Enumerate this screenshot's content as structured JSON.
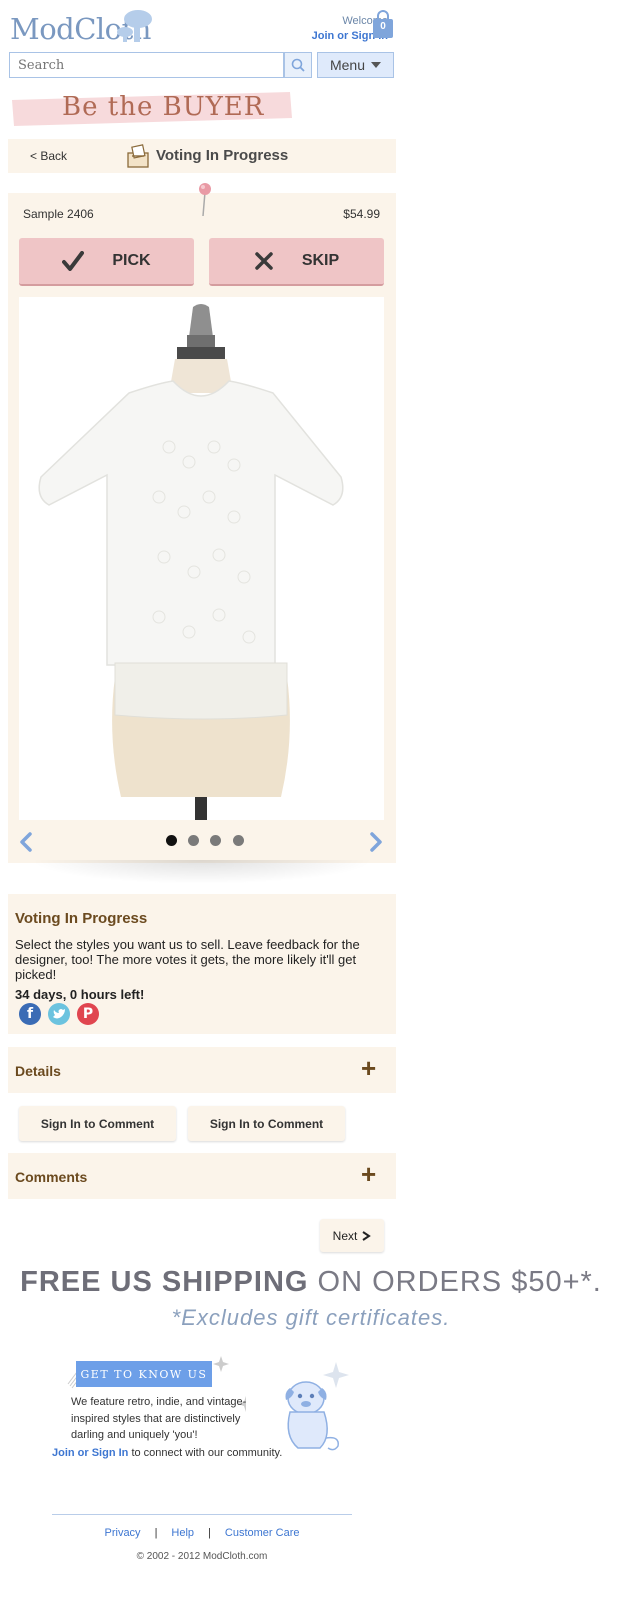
{
  "header": {
    "logo_text": "ModCloth",
    "welcome": "Welcome",
    "signin": "Join or Sign In",
    "bag_count": "0",
    "search_placeholder": "Search",
    "menu_label": "Menu"
  },
  "banner": {
    "text": "Be the BUYER"
  },
  "nav": {
    "back_label": "< Back",
    "title": "Voting In Progress"
  },
  "product": {
    "sample": "Sample 2406",
    "price": "$54.99",
    "pick_label": "PICK",
    "skip_label": "SKIP",
    "carousel": {
      "total": 4,
      "active": 1
    }
  },
  "info": {
    "title": "Voting In Progress",
    "description": "Select the styles you want us to sell. Leave feedback for the designer, too! The more votes it gets, the more likely it'll get picked!",
    "days_left": "34 days, 0 hours left!",
    "social": [
      "facebook",
      "twitter",
      "pinterest"
    ]
  },
  "details": {
    "label": "Details"
  },
  "comment_buttons": [
    "Sign In to Comment",
    "Sign In to Comment"
  ],
  "comments": {
    "label": "Comments"
  },
  "next_label": "Next",
  "footer": {
    "ship_bold": "FREE US SHIPPING",
    "ship_rest": " ON ORDERS $50+*.",
    "ship_note": "*Excludes gift certificates.",
    "gtk_label": "GET TO KNOW US",
    "gtk_desc": "We feature retro, indie, and vintage-inspired styles that are distinctively darling and uniquely 'you'!",
    "community_link": "Join or Sign In",
    "community_text": " to connect with our community.",
    "links": [
      "Privacy",
      "Help",
      "Customer Care"
    ],
    "copyright": "© 2002 - 2012 ModCloth.com"
  },
  "colors": {
    "accent_blue": "#3d76d1",
    "panel_bg": "#fbf4ea",
    "button_pink": "#efc5c6",
    "title_brown": "#6b4a1f"
  }
}
